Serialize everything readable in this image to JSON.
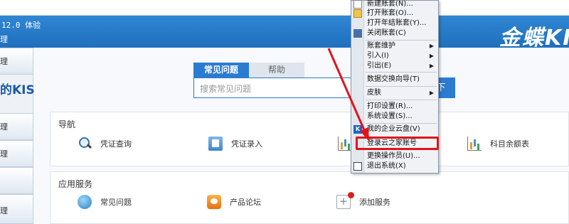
{
  "titlebar": {
    "version": "12.0 体验",
    "subtitle": "理",
    "brand": "金蝶KI"
  },
  "leftrail": {
    "logo": "的KIS",
    "tabs": [
      "理",
      "理",
      "",
      "理"
    ]
  },
  "search": {
    "tab_faq": "常见问题",
    "tab_help": "帮助",
    "placeholder": "搜索常见问题",
    "button": "下"
  },
  "nav_panel": {
    "title": "导航",
    "items": [
      {
        "label": "凭证查询",
        "icon": "magnifier-icon"
      },
      {
        "label": "凭证录入",
        "icon": "voucher-entry-icon"
      },
      {
        "label": "",
        "icon": "report-icon"
      },
      {
        "label": "科目余额表",
        "icon": "balance-chart-icon"
      }
    ]
  },
  "service_panel": {
    "title": "应用服务",
    "items": [
      {
        "label": "常见问题",
        "icon": "faq-globe-icon"
      },
      {
        "label": "产品论坛",
        "icon": "forum-icon"
      },
      {
        "label": "添加服务",
        "icon": "add-service-icon"
      }
    ]
  },
  "menu": {
    "items": [
      {
        "label": "新建账套(N)...",
        "icon": "new-file-icon"
      },
      {
        "label": "打开账套(O)...",
        "icon": "open-folder-icon"
      },
      {
        "label": "打开年结账套(Y)...",
        "icon": ""
      },
      {
        "label": "关闭账套(C)",
        "icon": "close-book-icon"
      },
      {
        "label": "账套维护",
        "submenu": true
      },
      {
        "label": "引入(I)",
        "submenu": true
      },
      {
        "label": "引出(E)",
        "submenu": true
      },
      {
        "label": "数据交换向导(T)"
      },
      {
        "label": "皮肤",
        "submenu": true
      },
      {
        "label": "打印设置(R)..."
      },
      {
        "label": "系统设置(S)..."
      },
      {
        "label": "我的企业云盘(V)",
        "icon": "cloud-drive-icon"
      },
      {
        "label": "登录云之家账号",
        "highlighted": true
      },
      {
        "label": "更换操作员(U)..."
      },
      {
        "label": "退出系统(X)",
        "icon": "exit-icon"
      }
    ]
  },
  "colors": {
    "title_blue": "#2f87d3",
    "highlight_red": "#e0141d",
    "accent_blue": "#2b7bd1"
  }
}
